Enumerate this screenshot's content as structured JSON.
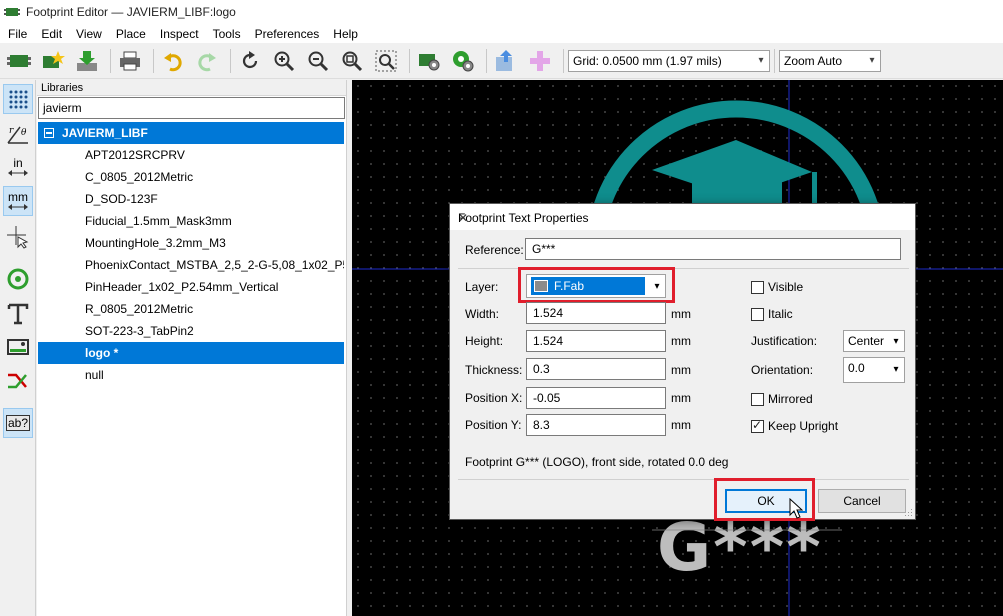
{
  "window": {
    "title": "Footprint Editor — JAVIERM_LIBF:logo"
  },
  "menu": [
    "File",
    "Edit",
    "View",
    "Place",
    "Inspect",
    "Tools",
    "Preferences",
    "Help"
  ],
  "toolbar": {
    "grid_value": "Grid: 0.0500 mm (1.97 mils)",
    "zoom_value": "Zoom Auto"
  },
  "left_tools": {
    "inches_label": "in",
    "mm_label": "mm",
    "text_tool_label": "ab?"
  },
  "libraries": {
    "header": "Libraries",
    "filter_value": "javierm",
    "root": "JAVIERM_LIBF",
    "items": [
      "APT2012SRCPRV",
      "C_0805_2012Metric",
      "D_SOD-123F",
      "Fiducial_1.5mm_Mask3mm",
      "MountingHole_3.2mm_M3",
      "PhoenixContact_MSTBA_2,5_2-G-5,08_1x02_P5.08",
      "PinHeader_1x02_P2.54mm_Vertical",
      "R_0805_2012Metric",
      "SOT-223-3_TabPin2",
      "logo *",
      "null"
    ],
    "selected_index": 9
  },
  "canvas": {
    "ref_text": "G***"
  },
  "dialog": {
    "title": "Footprint Text Properties",
    "reference_label": "Reference:",
    "reference_value": "G***",
    "layer_label": "Layer:",
    "layer_value": "F.Fab",
    "width_label": "Width:",
    "width_value": "1.524",
    "height_label": "Height:",
    "height_value": "1.524",
    "thickness_label": "Thickness:",
    "thickness_value": "0.3",
    "posx_label": "Position X:",
    "posx_value": "-0.05",
    "posy_label": "Position Y:",
    "posy_value": "8.3",
    "unit": "mm",
    "visible_label": "Visible",
    "visible_checked": false,
    "italic_label": "Italic",
    "italic_checked": false,
    "justification_label": "Justification:",
    "justification_value": "Center",
    "orientation_label": "Orientation:",
    "orientation_value": "0.0",
    "mirrored_label": "Mirrored",
    "mirrored_checked": false,
    "keep_upright_label": "Keep Upright",
    "keep_upright_checked": true,
    "status_text": "Footprint G*** (LOGO), front side, rotated 0.0 deg",
    "ok_label": "OK",
    "cancel_label": "Cancel"
  },
  "colors": {
    "selection": "#0078d7",
    "canvas_bg": "#000000",
    "logo_teal": "#0f8d8d",
    "highlight_red": "#e01e2c",
    "fab_text": "#bdbdbd"
  }
}
